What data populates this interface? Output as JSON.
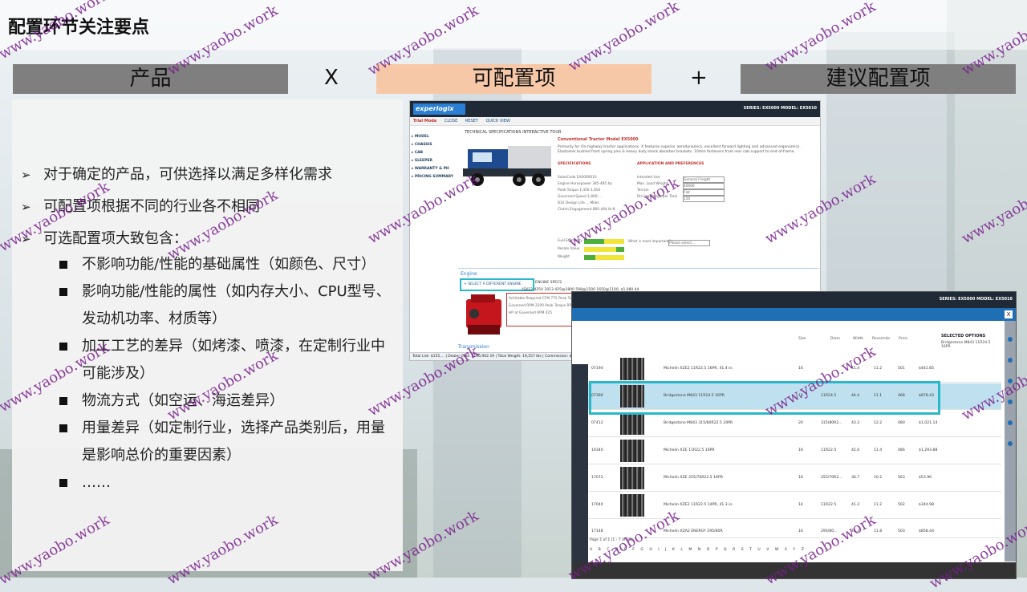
{
  "page": {
    "title": "配置环节关注要点",
    "headers": [
      "产品",
      "X",
      "可配置项",
      "+",
      "建议配置项"
    ]
  },
  "bullets": {
    "level1": [
      "对于确定的产品，可供选择以满足多样化需求",
      "可配置项根据不同的行业各不相同",
      "可选配置项大致包含："
    ],
    "level2": [
      "不影响功能/性能的基础属性（如颜色、尺寸）",
      "影响功能/性能的属性（如内存大小、CPU型号、发动机功率、材质等）",
      "加工工艺的差异（如烤漆、喷漆，在定制行业中可能涉及）",
      "物流方式（如空运、海运差异）",
      "用量差异（如定制行业，选择产品类别后，用量是影响总价的重要因素）",
      "……"
    ],
    "marker1": "➢"
  },
  "shot1": {
    "logo": "experlogix",
    "series": "SERIES: EX5000   MODEL: EX5010",
    "toolbar": [
      "Trial Mode",
      "CLOSE",
      "RESET",
      "QUICK VIEW"
    ],
    "tabs": "TECHNICAL SPECIFICATIONS     INTERACTIVE TOUR",
    "nav": [
      "▸ MODEL",
      "▸ CHASSIS",
      "▸ CAB",
      "▸ SLEEPER",
      "▸ WARRANTY & PH",
      "▸ PRICING SUMMARY"
    ],
    "heading": "Conventional Tractor Model EX5000",
    "description": "Primarily for On-highway tractor applications. X features superior aerodynamics, excellent forward lighting and advanced ergonomics. Elastomer bushed front spring pins & heavy duty shock absorber brackets. 10mm fasteners from rear cab support to end-of-frame.",
    "specifications": "SPECIFICATIONS",
    "application": "APPLICATION AND PREFERENCES",
    "spec_rows": [
      "SalesCode   EX0000610",
      "Engine Horsepower   385-485 hp",
      "Peak Torque   1,450-1,650",
      "Governed Speed   1,800-...",
      "B10 Design Life   ... Miles",
      "Clutch Engagement   860-464 lb-ft"
    ],
    "app_rows": [
      "Intended Use",
      "Max. Load Weight",
      "Terrain",
      "Driving Range per Tank"
    ],
    "app_values": [
      "General Freight",
      "40000",
      "Flat",
      "150"
    ],
    "perf_rows": [
      "Fuel Efficiency",
      "Resale Value",
      "Weight"
    ],
    "important": "What is most important?",
    "important_value": "Please select...",
    "engine_title": "Engine",
    "engine_button": "+ SELECT A DIFFERENT ENGINE",
    "engine_specs": "ENGINE SPECS",
    "engine_line": "ISX12 425V 2013 425@1800 598@1500 1650@1100,        $1,080.44",
    "engine_table": [
      "Achitable Required CFM  775   Peak Torque  1650   Clutch Engagement Torque  860",
      "Governed RPM  2100   Peak Torque RPM  1200   Torque Curve Code  PR2040CV",
      "HP at Governed RPM  425"
    ],
    "transmission": "Transmission",
    "footer": "Total List: $155,...  |  Dealer Cost: $136,902.19  |  Total Weight: 19,557 lbs  |  Commission: $18,367.95  |  Country: ...  |  Gross Profit: 51.47%  |  State: TX"
  },
  "shot2": {
    "series": "SERIES: EX5000   MODEL: EX5010",
    "close": "X",
    "columns": [
      "Size",
      "Diam",
      "Width",
      "Revs/mile",
      "Price"
    ],
    "selected_title": "SELECTED OPTIONS",
    "selected_item": "Bridgestone M843 11R24.5 16PR",
    "rows": [
      {
        "code": "07194",
        "name": "Michelin XZE2 11R22.5 16PR, 41.4 in.",
        "ply": "16",
        "size": "",
        "diam": "41.4",
        "width": "11.2",
        "revs": "501",
        "price": "$441.85"
      },
      {
        "code": "07396",
        "name": "Bridgestone M843 11R24.5 16PR",
        "ply": "16",
        "size": "11R24.5",
        "diam": "44.4",
        "width": "11.1",
        "revs": "468",
        "price": "$878.43"
      },
      {
        "code": "07412",
        "name": "Bridgestone M843 315/80R22.5 20PR",
        "ply": "20",
        "size": "315/80R2...",
        "diam": "43.3",
        "width": "12.2",
        "revs": "480",
        "price": "$1,021.14"
      },
      {
        "code": "10340",
        "name": "Michelin XZE 11R22.5 16PR",
        "ply": "16",
        "size": "11R22.5",
        "diam": "42.6",
        "width": "11.4",
        "revs": "486",
        "price": "$1,293.88"
      },
      {
        "code": "17072",
        "name": "Michelin XZE 255/70R22.5 16PR",
        "ply": "16",
        "size": "255/70R2...",
        "diam": "36.7",
        "width": "10.2",
        "revs": "563",
        "price": "$53.96"
      },
      {
        "code": "17040",
        "name": "Michelin XZE2 11R22.5 14PR, 41.3 in.",
        "ply": "14",
        "size": "11R22.5",
        "diam": "41.3",
        "width": "11.2",
        "revs": "502",
        "price": "$344.98"
      },
      {
        "code": "17148",
        "name": "Michelin XZA2 ENERGY 295/80R",
        "ply": "16",
        "size": "295/80...",
        "diam": "41.3",
        "width": "11.8",
        "revs": "503",
        "price": "$858.44"
      }
    ],
    "paging": "Page 1 of 1 (1 - 7 of 28)",
    "alphabet": "A B C D E F G H I J K L M N O P Q R S T U V W X Y Z"
  },
  "watermark": "www.yaobo.work",
  "colors": {
    "gray_header": "#7f7f7f",
    "peach_header": "#f7c8a8",
    "highlight": "#29b8c9",
    "watermark": "#7a1e8c"
  }
}
